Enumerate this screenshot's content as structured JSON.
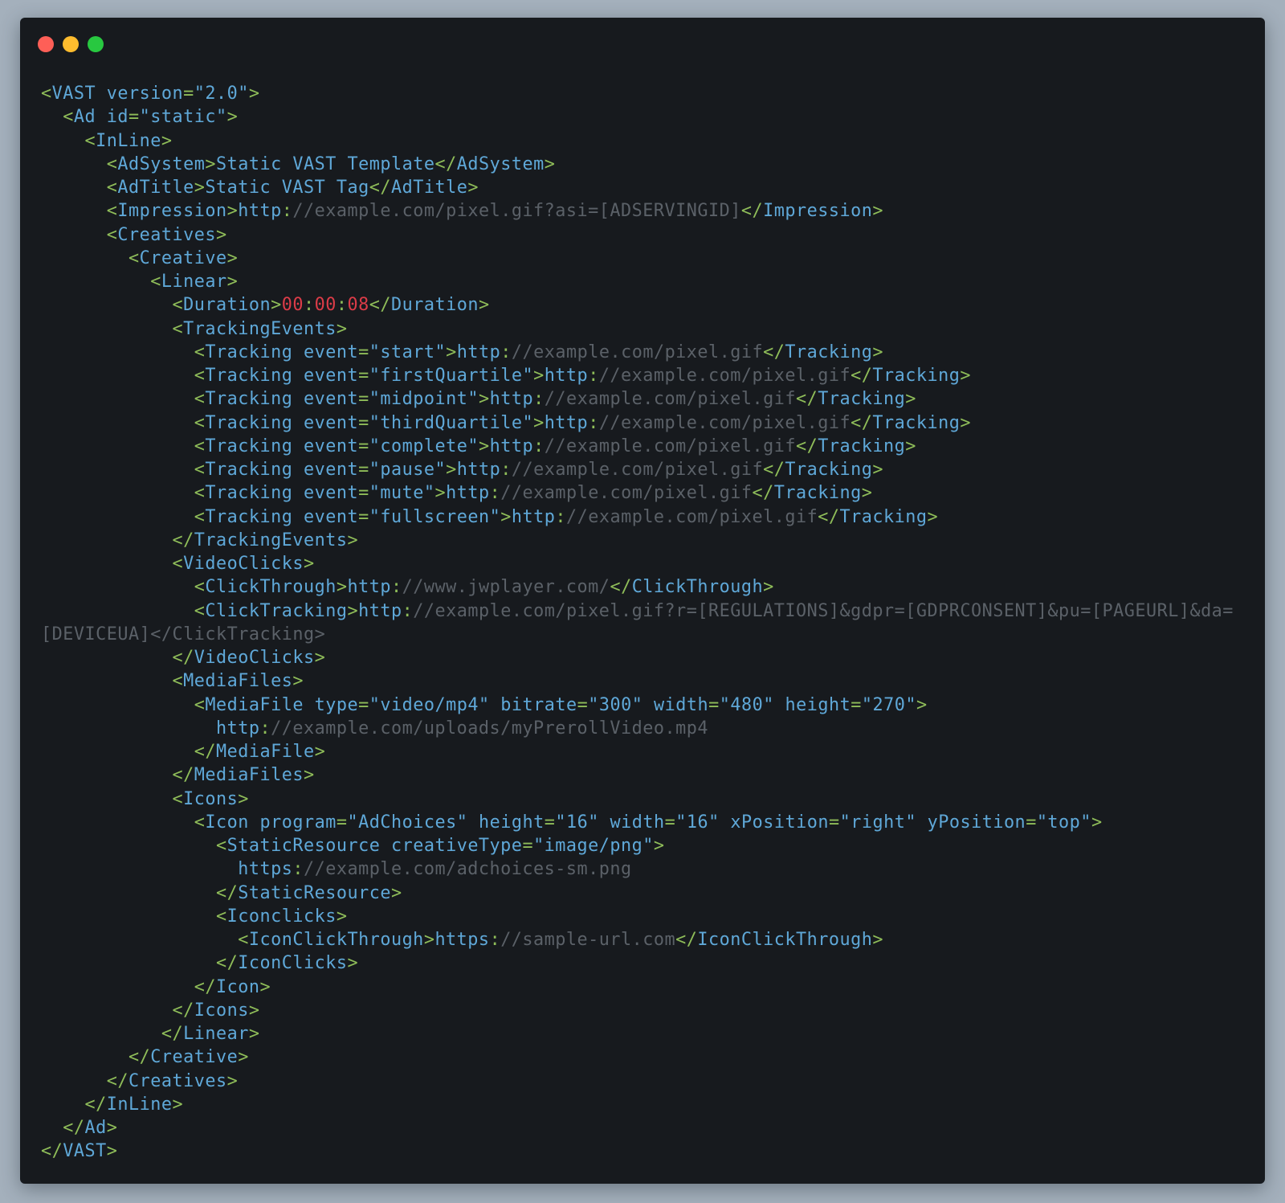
{
  "window_controls": [
    "close",
    "minimize",
    "zoom"
  ],
  "colors": {
    "background": "#a4b0bc",
    "editor_bg": "#171a1e",
    "punctuation": "#8fbd59",
    "tag": "#5fa8d8",
    "comment_url": "#5b6168",
    "number": "#dc3c48"
  },
  "code_lines": [
    "<VAST version=\"2.0\">",
    "  <Ad id=\"static\">",
    "    <InLine>",
    "      <AdSystem>Static VAST Template</AdSystem>",
    "      <AdTitle>Static VAST Tag</AdTitle>",
    "      <Impression>http://example.com/pixel.gif?asi=[ADSERVINGID]</Impression>",
    "      <Creatives>",
    "        <Creative>",
    "          <Linear>",
    "            <Duration>00:00:08</Duration>",
    "            <TrackingEvents>",
    "              <Tracking event=\"start\">http://example.com/pixel.gif</Tracking>",
    "              <Tracking event=\"firstQuartile\">http://example.com/pixel.gif</Tracking>",
    "              <Tracking event=\"midpoint\">http://example.com/pixel.gif</Tracking>",
    "              <Tracking event=\"thirdQuartile\">http://example.com/pixel.gif</Tracking>",
    "              <Tracking event=\"complete\">http://example.com/pixel.gif</Tracking>",
    "              <Tracking event=\"pause\">http://example.com/pixel.gif</Tracking>",
    "              <Tracking event=\"mute\">http://example.com/pixel.gif</Tracking>",
    "              <Tracking event=\"fullscreen\">http://example.com/pixel.gif</Tracking>",
    "            </TrackingEvents>",
    "            <VideoClicks>",
    "              <ClickThrough>http://www.jwplayer.com/</ClickThrough>",
    "              <ClickTracking>http://example.com/pixel.gif?r=[REGULATIONS]&gdpr=[GDPRCONSENT]&pu=[PAGEURL]&da=",
    "[DEVICEUA]</ClickTracking>",
    "            </VideoClicks>",
    "            <MediaFiles>",
    "              <MediaFile type=\"video/mp4\" bitrate=\"300\" width=\"480\" height=\"270\">",
    "                http://example.com/uploads/myPrerollVideo.mp4",
    "              </MediaFile>",
    "            </MediaFiles>",
    "            <Icons>",
    "              <Icon program=\"AdChoices\" height=\"16\" width=\"16\" xPosition=\"right\" yPosition=\"top\">",
    "                <StaticResource creativeType=\"image/png\">",
    "                  https://example.com/adchoices-sm.png",
    "                </StaticResource>",
    "                <Iconclicks>",
    "                  <IconClickThrough>https://sample-url.com</IconClickThrough>",
    "                </IconClicks>",
    "              </Icon>",
    "            </Icons>",
    "           </Linear>",
    "        </Creative>",
    "      </Creatives>",
    "    </InLine>",
    "  </Ad>",
    "</VAST>"
  ]
}
